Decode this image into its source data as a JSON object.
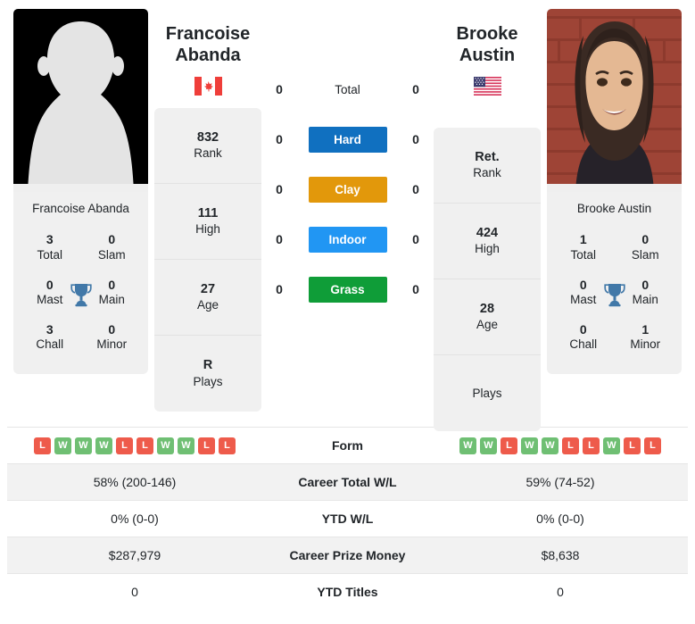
{
  "players": {
    "left": {
      "first_name": "Francoise",
      "last_name": "Abanda",
      "full_name": "Francoise Abanda",
      "country": "Canada",
      "flag_icon": "flag-canada-icon",
      "photo_type": "placeholder-silhouette-photo",
      "rank": {
        "value": "832",
        "label": "Rank"
      },
      "high": {
        "value": "111",
        "label": "High"
      },
      "age": {
        "value": "27",
        "label": "Age"
      },
      "plays": {
        "value": "R",
        "label": "Plays"
      },
      "titles": [
        {
          "value": "3",
          "label": "Total"
        },
        {
          "value": "0",
          "label": "Slam"
        },
        {
          "value": "0",
          "label": "Mast"
        },
        {
          "value": "0",
          "label": "Main"
        },
        {
          "value": "3",
          "label": "Chall"
        },
        {
          "value": "0",
          "label": "Minor"
        }
      ],
      "form": [
        "L",
        "W",
        "W",
        "W",
        "L",
        "L",
        "W",
        "W",
        "L",
        "L"
      ],
      "career_total_wl": "58% (200-146)",
      "ytd_wl": "0% (0-0)",
      "career_prize_money": "$287,979",
      "ytd_titles": "0",
      "h2h": {
        "total": "0",
        "hard": "0",
        "clay": "0",
        "indoor": "0",
        "grass": "0"
      }
    },
    "right": {
      "first_name": "Brooke",
      "last_name": "Austin",
      "full_name": "Brooke Austin",
      "country": "United States",
      "flag_icon": "flag-usa-icon",
      "photo_type": "player-portrait-photo",
      "rank": {
        "value": "Ret.",
        "label": "Rank"
      },
      "high": {
        "value": "424",
        "label": "High"
      },
      "age": {
        "value": "28",
        "label": "Age"
      },
      "plays": {
        "value": "",
        "label": "Plays"
      },
      "titles": [
        {
          "value": "1",
          "label": "Total"
        },
        {
          "value": "0",
          "label": "Slam"
        },
        {
          "value": "0",
          "label": "Mast"
        },
        {
          "value": "0",
          "label": "Main"
        },
        {
          "value": "0",
          "label": "Chall"
        },
        {
          "value": "1",
          "label": "Minor"
        }
      ],
      "form": [
        "W",
        "W",
        "L",
        "W",
        "W",
        "L",
        "L",
        "W",
        "L",
        "L"
      ],
      "career_total_wl": "59% (74-52)",
      "ytd_wl": "0% (0-0)",
      "career_prize_money": "$8,638",
      "ytd_titles": "0",
      "h2h": {
        "total": "0",
        "hard": "0",
        "clay": "0",
        "indoor": "0",
        "grass": "0"
      }
    }
  },
  "surfaces": [
    {
      "key": "total",
      "label": "Total",
      "style": "plain",
      "color": ""
    },
    {
      "key": "hard",
      "label": "Hard",
      "style": "badge",
      "color": "#1070c0"
    },
    {
      "key": "clay",
      "label": "Clay",
      "style": "badge",
      "color": "#e2980b"
    },
    {
      "key": "indoor",
      "label": "Indoor",
      "style": "badge",
      "color": "#2196f3"
    },
    {
      "key": "grass",
      "label": "Grass",
      "style": "badge",
      "color": "#0f9d38"
    }
  ],
  "table": {
    "rows": [
      {
        "key": "form",
        "label": "Form",
        "type": "form"
      },
      {
        "key": "career_total_wl",
        "label": "Career Total W/L",
        "type": "text"
      },
      {
        "key": "ytd_wl",
        "label": "YTD W/L",
        "type": "text"
      },
      {
        "key": "career_prize_money",
        "label": "Career Prize Money",
        "type": "text"
      },
      {
        "key": "ytd_titles",
        "label": "YTD Titles",
        "type": "text"
      }
    ]
  },
  "colors": {
    "win_badge": "#6fbf73",
    "loss_badge": "#ee5b4b",
    "panel_bg": "#f0f0f0",
    "row_shade": "#f2f2f2",
    "trophy": "#4178a8"
  },
  "icons": {
    "trophy": "trophy-icon"
  }
}
